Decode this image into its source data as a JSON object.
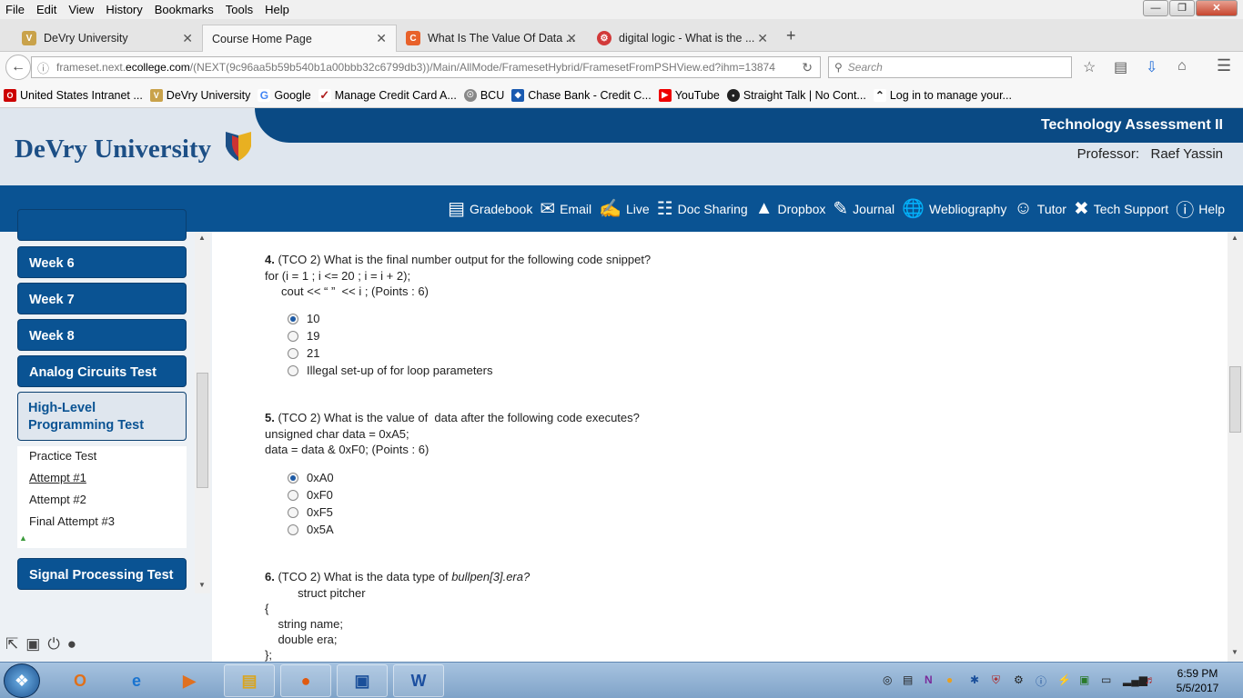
{
  "menu": [
    "File",
    "Edit",
    "View",
    "History",
    "Bookmarks",
    "Tools",
    "Help"
  ],
  "tabs": [
    {
      "label": "DeVry University",
      "active": false
    },
    {
      "label": "Course Home Page",
      "active": true
    },
    {
      "label": "What Is The Value Of Data ...",
      "active": false
    },
    {
      "label": "digital logic - What is the ...",
      "active": false
    }
  ],
  "url": {
    "prefix": "frameset.next.",
    "host": "ecollege.com",
    "path": "/(NEXT(9c96aa5b59b540b1a00bbb32c6799db3))/Main/AllMode/FramesetHybrid/FramesetFromPSHView.ed?ihm=13874"
  },
  "search_placeholder": "Search",
  "bookmarks": [
    "United States Intranet ...",
    "DeVry University",
    "Google",
    "Manage Credit Card A...",
    "BCU",
    "Chase Bank - Credit C...",
    "YouTube",
    "Straight Talk | No Cont...",
    "Log in to manage your..."
  ],
  "header": {
    "logo": "DeVry University",
    "course": "Technology Assessment II",
    "professor_label": "Professor:",
    "professor_name": "Raef Yassin"
  },
  "course_nav": [
    "Gradebook",
    "Email",
    "Live",
    "Doc Sharing",
    "Dropbox",
    "Journal",
    "Webliography",
    "Tutor",
    "Tech Support",
    "Help"
  ],
  "sidebar": {
    "items": [
      "Week 6",
      "Week 7",
      "Week 8",
      "Analog Circuits Test"
    ],
    "open_item": {
      "line1": "High-Level",
      "line2": "Programming Test"
    },
    "subitems": [
      "Practice Test",
      "Attempt #1",
      "Attempt #2",
      "Final Attempt #3"
    ],
    "last_item": "Signal Processing Test"
  },
  "questions": [
    {
      "num": "4.",
      "text": " (TCO 2) What is the final number output for the following code snippet?",
      "lines": [
        "for (i = 1 ; i <= 20 ; i = i + 2);",
        "     cout << “ ”  << i ; (Points : 6)"
      ],
      "options": [
        "10",
        "19",
        "21",
        "Illegal set-up of for loop parameters"
      ],
      "selected": 0
    },
    {
      "num": "5.",
      "text": " (TCO 2) What is the value of  data after the following code executes?",
      "lines": [
        "unsigned char data = 0xA5;",
        "data = data & 0xF0; (Points : 6)"
      ],
      "options": [
        "0xA0",
        "0xF0",
        "0xF5",
        "0x5A"
      ],
      "selected": 0
    },
    {
      "num": "6.",
      "text": " (TCO 2) What is the data type of ",
      "italic": "bullpen[3].era?",
      "lines": [
        "          struct pitcher",
        "{",
        "    string name;",
        "    double era;",
        "};"
      ]
    }
  ],
  "clock": {
    "time": "6:59 PM",
    "date": "5/5/2017"
  }
}
